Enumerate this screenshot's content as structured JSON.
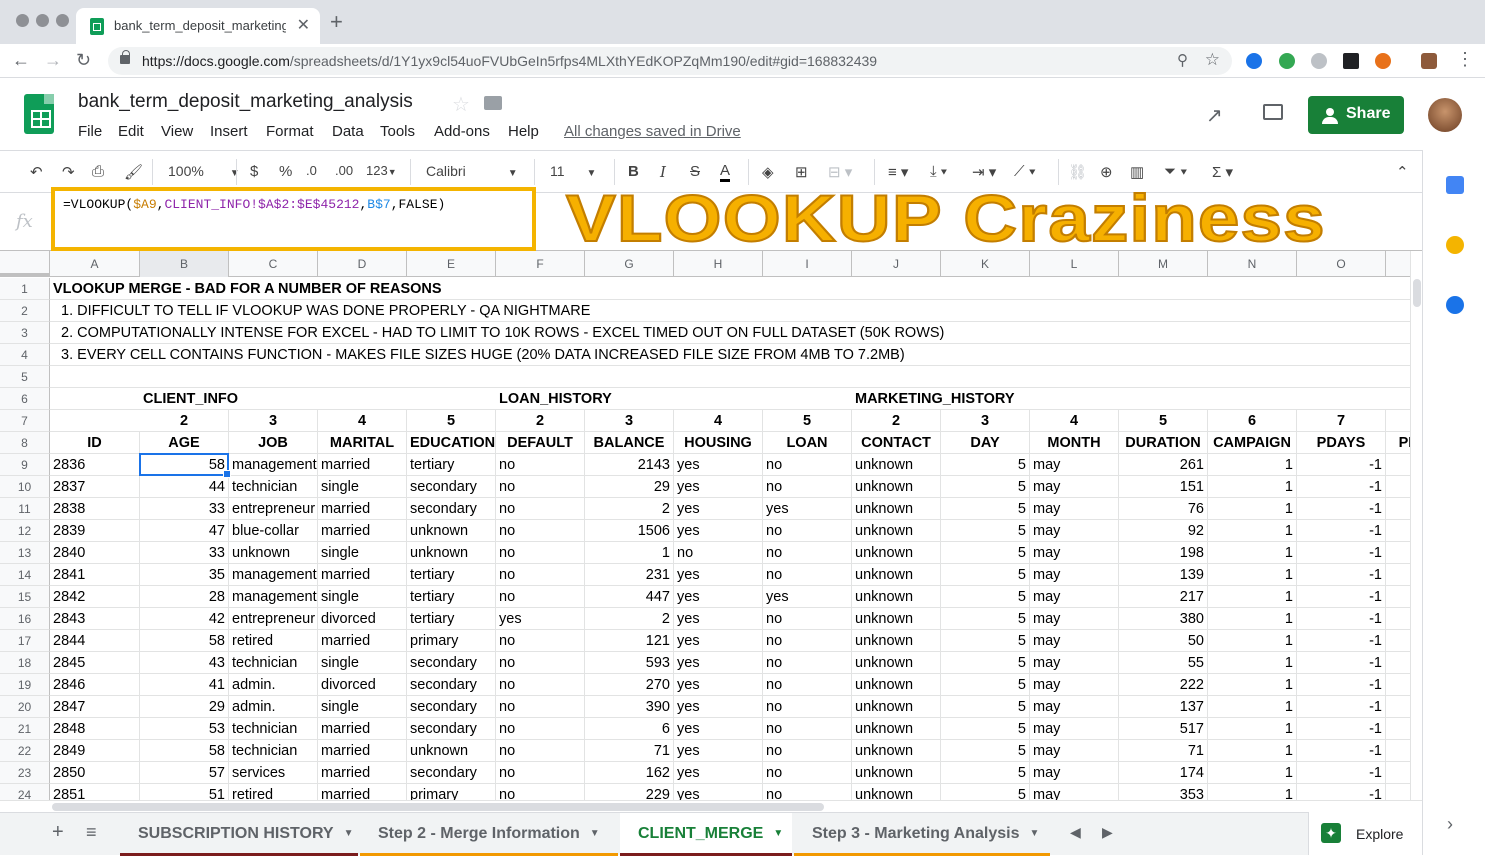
{
  "browser": {
    "tab_title": "bank_term_deposit_marketing_",
    "url_host": "https://docs.google.com",
    "url_path": "/spreadsheets/d/1Y1yx9cl54uoFVUbGeIn5rfps4MLXthYEdKOPZqMm190/edit#gid=168832439"
  },
  "doc": {
    "title": "bank_term_deposit_marketing_analysis",
    "menus": [
      "File",
      "Edit",
      "View",
      "Insert",
      "Format",
      "Data",
      "Tools",
      "Add-ons",
      "Help"
    ],
    "saved_status": "All changes saved in Drive",
    "share_label": "Share"
  },
  "toolbar": {
    "zoom": "100%",
    "currency": "$",
    "percent": "%",
    "dec_less": ".0",
    "dec_more": ".00",
    "more_formats": "123",
    "font": "Calibri",
    "font_size": "11"
  },
  "formula": {
    "fx": "fx",
    "prefix": "=VLOOKUP(",
    "ref_a9": "$A9",
    "comma1": ",",
    "ref_range": "CLIENT_INFO!$A$2:$E$45212",
    "comma2": ",",
    "ref_b7": "B$7",
    "suffix": ",FALSE)"
  },
  "overlay_title": "VLOOKUP Craziness",
  "columns": [
    "A",
    "B",
    "C",
    "D",
    "E",
    "F",
    "G",
    "H",
    "I",
    "J",
    "K",
    "L",
    "M",
    "N",
    "O"
  ],
  "selected_column": "B",
  "row_numbers": [
    "1",
    "2",
    "3",
    "4",
    "5",
    "6",
    "7",
    "8",
    "9",
    "10",
    "11",
    "12",
    "13",
    "14",
    "15",
    "16",
    "17",
    "18",
    "19",
    "20",
    "21",
    "22",
    "23",
    "24"
  ],
  "notes": {
    "r1": "VLOOKUP MERGE - BAD FOR A NUMBER OF REASONS",
    "r2": "  1. DIFFICULT TO TELL IF VLOOKUP WAS DONE PROPERLY - QA NIGHTMARE",
    "r3": "  2. COMPUTATIONALLY INTENSE FOR EXCEL - HAD TO LIMIT TO 10K ROWS - EXCEL TIMED OUT ON FULL DATASET (50K ROWS)",
    "r4": "  3. EVERY CELL CONTAINS FUNCTION - MAKES FILE SIZES HUGE (20% DATA INCREASED FILE SIZE FROM 4MB TO 7.2MB)"
  },
  "groups": {
    "b": "CLIENT_INFO",
    "f": "LOAN_HISTORY",
    "j": "MARKETING_HISTORY"
  },
  "index_row": [
    "",
    "2",
    "3",
    "4",
    "5",
    "2",
    "3",
    "4",
    "5",
    "2",
    "3",
    "4",
    "5",
    "6",
    "7"
  ],
  "headers": [
    "ID",
    "AGE",
    "JOB",
    "MARITAL",
    "EDUCATION",
    "DEFAULT",
    "BALANCE",
    "HOUSING",
    "LOAN",
    "CONTACT",
    "DAY",
    "MONTH",
    "DURATION",
    "CAMPAIGN",
    "PDAYS",
    "PI"
  ],
  "rows": [
    [
      "2836",
      "58",
      "management",
      "married",
      "tertiary",
      "no",
      "2143",
      "yes",
      "no",
      "unknown",
      "5",
      "may",
      "261",
      "1",
      "-1"
    ],
    [
      "2837",
      "44",
      "technician",
      "single",
      "secondary",
      "no",
      "29",
      "yes",
      "no",
      "unknown",
      "5",
      "may",
      "151",
      "1",
      "-1"
    ],
    [
      "2838",
      "33",
      "entrepreneur",
      "married",
      "secondary",
      "no",
      "2",
      "yes",
      "yes",
      "unknown",
      "5",
      "may",
      "76",
      "1",
      "-1"
    ],
    [
      "2839",
      "47",
      "blue-collar",
      "married",
      "unknown",
      "no",
      "1506",
      "yes",
      "no",
      "unknown",
      "5",
      "may",
      "92",
      "1",
      "-1"
    ],
    [
      "2840",
      "33",
      "unknown",
      "single",
      "unknown",
      "no",
      "1",
      "no",
      "no",
      "unknown",
      "5",
      "may",
      "198",
      "1",
      "-1"
    ],
    [
      "2841",
      "35",
      "management",
      "married",
      "tertiary",
      "no",
      "231",
      "yes",
      "no",
      "unknown",
      "5",
      "may",
      "139",
      "1",
      "-1"
    ],
    [
      "2842",
      "28",
      "management",
      "single",
      "tertiary",
      "no",
      "447",
      "yes",
      "yes",
      "unknown",
      "5",
      "may",
      "217",
      "1",
      "-1"
    ],
    [
      "2843",
      "42",
      "entrepreneur",
      "divorced",
      "tertiary",
      "yes",
      "2",
      "yes",
      "no",
      "unknown",
      "5",
      "may",
      "380",
      "1",
      "-1"
    ],
    [
      "2844",
      "58",
      "retired",
      "married",
      "primary",
      "no",
      "121",
      "yes",
      "no",
      "unknown",
      "5",
      "may",
      "50",
      "1",
      "-1"
    ],
    [
      "2845",
      "43",
      "technician",
      "single",
      "secondary",
      "no",
      "593",
      "yes",
      "no",
      "unknown",
      "5",
      "may",
      "55",
      "1",
      "-1"
    ],
    [
      "2846",
      "41",
      "admin.",
      "divorced",
      "secondary",
      "no",
      "270",
      "yes",
      "no",
      "unknown",
      "5",
      "may",
      "222",
      "1",
      "-1"
    ],
    [
      "2847",
      "29",
      "admin.",
      "single",
      "secondary",
      "no",
      "390",
      "yes",
      "no",
      "unknown",
      "5",
      "may",
      "137",
      "1",
      "-1"
    ],
    [
      "2848",
      "53",
      "technician",
      "married",
      "secondary",
      "no",
      "6",
      "yes",
      "no",
      "unknown",
      "5",
      "may",
      "517",
      "1",
      "-1"
    ],
    [
      "2849",
      "58",
      "technician",
      "married",
      "unknown",
      "no",
      "71",
      "yes",
      "no",
      "unknown",
      "5",
      "may",
      "71",
      "1",
      "-1"
    ],
    [
      "2850",
      "57",
      "services",
      "married",
      "secondary",
      "no",
      "162",
      "yes",
      "no",
      "unknown",
      "5",
      "may",
      "174",
      "1",
      "-1"
    ],
    [
      "2851",
      "51",
      "retired",
      "married",
      "primary",
      "no",
      "229",
      "yes",
      "no",
      "unknown",
      "5",
      "may",
      "353",
      "1",
      "-1"
    ]
  ],
  "sheet_tabs": [
    "SUBSCRIPTION HISTORY",
    "Step 2 - Merge Information",
    "CLIENT_MERGE",
    "Step 3 - Marketing Analysis"
  ],
  "active_sheet": "CLIENT_MERGE",
  "explore_label": "Explore",
  "colors": {
    "accent_green": "#188038",
    "highlight": "#f4b400",
    "selection": "#1a73e8"
  }
}
